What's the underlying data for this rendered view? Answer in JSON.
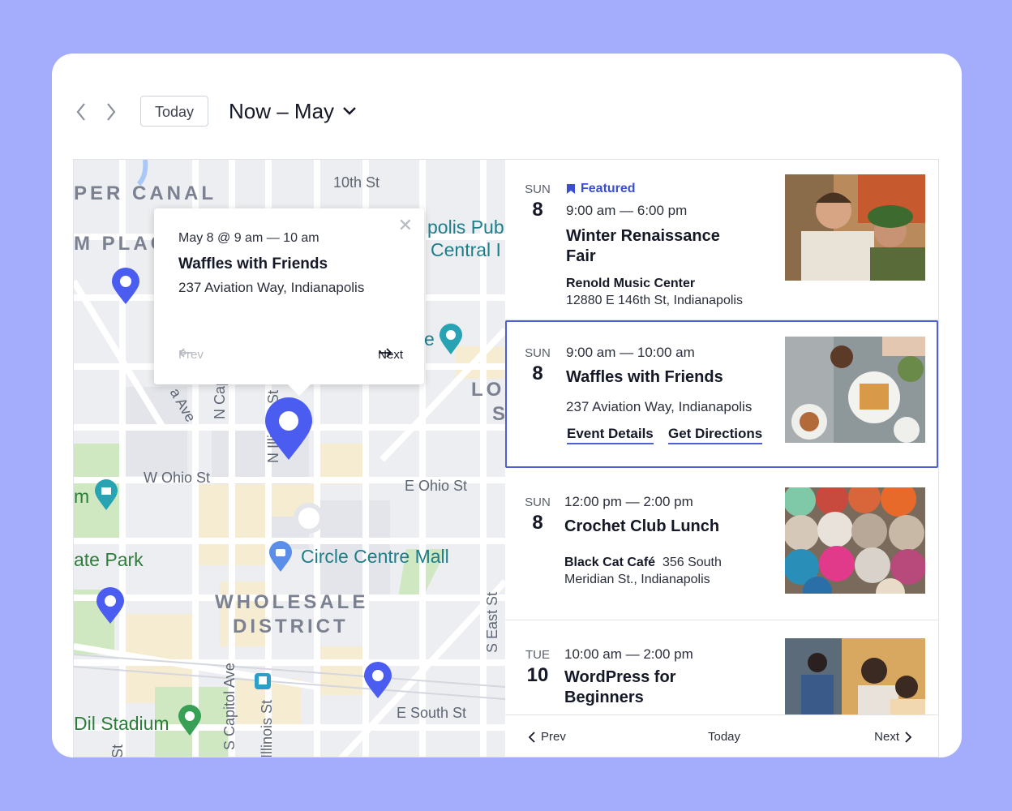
{
  "toolbar": {
    "today_label": "Today",
    "range_label": "Now – May"
  },
  "map": {
    "streets": [
      "10th St",
      "W Ohio St",
      "E Ohio St",
      "N Capitol Av",
      "N Illinois St",
      "S East St",
      "S Capitol Ave",
      "E South St",
      "Illinois St",
      "St",
      "a Ave"
    ],
    "areas": [
      "PER CANAL",
      "M PLAC",
      "WHOLESALE",
      "DISTRICT",
      "LO",
      "S"
    ],
    "pois": [
      "polis Pub",
      "Central I",
      "Circle Centre Mall",
      "e"
    ],
    "parks": [
      "ate Park",
      "Dil Stadium",
      "m"
    ],
    "popup": {
      "time": "May 8 @ 9 am — 10 am",
      "title": "Waffles with Friends",
      "address": "237 Aviation Way, Indianapolis",
      "prev_label": "Prev",
      "next_label": "Next"
    }
  },
  "events": [
    {
      "dow": "SUN",
      "day": "8",
      "featured_label": "Featured",
      "time": "9:00 am — 6:00 pm",
      "title": "Winter Renaissance Fair",
      "venue_name": "Renold Music Center",
      "venue_address": "12880 E 146th St, Indianapolis",
      "image": "renaissance-fair-photo"
    },
    {
      "dow": "SUN",
      "day": "8",
      "time": "9:00 am — 10:00 am",
      "title": "Waffles with Friends",
      "address": "237 Aviation Way, Indianapolis",
      "details_label": "Event Details",
      "directions_label": "Get Directions",
      "image": "waffles-table-photo"
    },
    {
      "dow": "SUN",
      "day": "8",
      "time": "12:00 pm — 2:00 pm",
      "title": "Crochet Club Lunch",
      "venue_name": "Black Cat Café",
      "venue_address": "356 South Meridian St., Indianapolis",
      "image": "yarn-balls-photo"
    },
    {
      "dow": "TUE",
      "day": "10",
      "time": "10:00 am — 2:00 pm",
      "title": "WordPress for Beginners",
      "image": "laptop-class-photo"
    }
  ],
  "list_footer": {
    "prev_label": "Prev",
    "today_label": "Today",
    "next_label": "Next"
  },
  "colors": {
    "background": "#a4adfb",
    "accent": "#4c5fd5",
    "pin": "#4a5df0"
  }
}
